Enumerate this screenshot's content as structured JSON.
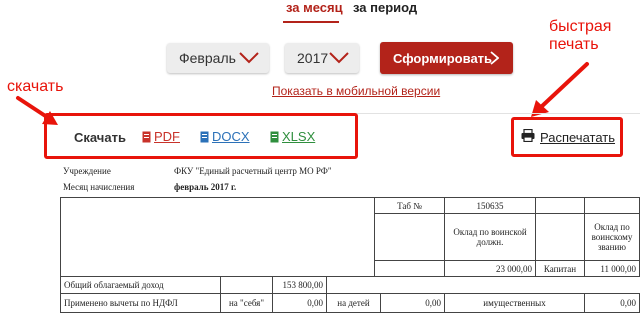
{
  "tabs": {
    "active": "за месяц",
    "inactive": "за период"
  },
  "filters": {
    "month": "Февраль",
    "year": "2017",
    "generate_label": "Сформировать"
  },
  "mobile_link": "Показать в мобильной версии",
  "annotations": {
    "download": "скачать",
    "print_line1": "быстрая",
    "print_line2": "печать"
  },
  "download": {
    "label": "Скачать",
    "pdf": "PDF",
    "docx": "DOCX",
    "xlsx": "XLSX"
  },
  "print_label": "Распечатать",
  "meta": {
    "institution_label": "Учреждение",
    "institution_value": "ФКУ \"Единый расчетный центр МО РФ\"",
    "month_label": "Месяц начисления",
    "month_value": "февраль 2017 г."
  },
  "table": {
    "tab_label": "Таб №",
    "tab_value": "150635",
    "salary_position_label": "Оклад по воинской должн.",
    "salary_rank_label": "Оклад по воинскому званию",
    "salary_position_value": "23 000,00",
    "rank": "Капитан",
    "salary_rank_value": "11 000,00",
    "taxable_income_label": "Общий облагаемый доход",
    "taxable_income_value": "153 800,00",
    "deductions_label": "Применено вычеты по НДФЛ",
    "self_label": "на \"себя\"",
    "self_value": "0,00",
    "children_label": "на детей",
    "children_value": "0,00",
    "property_label": "имущественных",
    "property_value": "0,00"
  },
  "colors": {
    "brand_red": "#b3231a",
    "annotation_red": "#e8140b"
  },
  "icons": [
    "chevron-down-icon",
    "chevron-right-icon",
    "pdf-file-icon",
    "docx-file-icon",
    "xlsx-file-icon",
    "printer-icon",
    "arrow-icon"
  ]
}
